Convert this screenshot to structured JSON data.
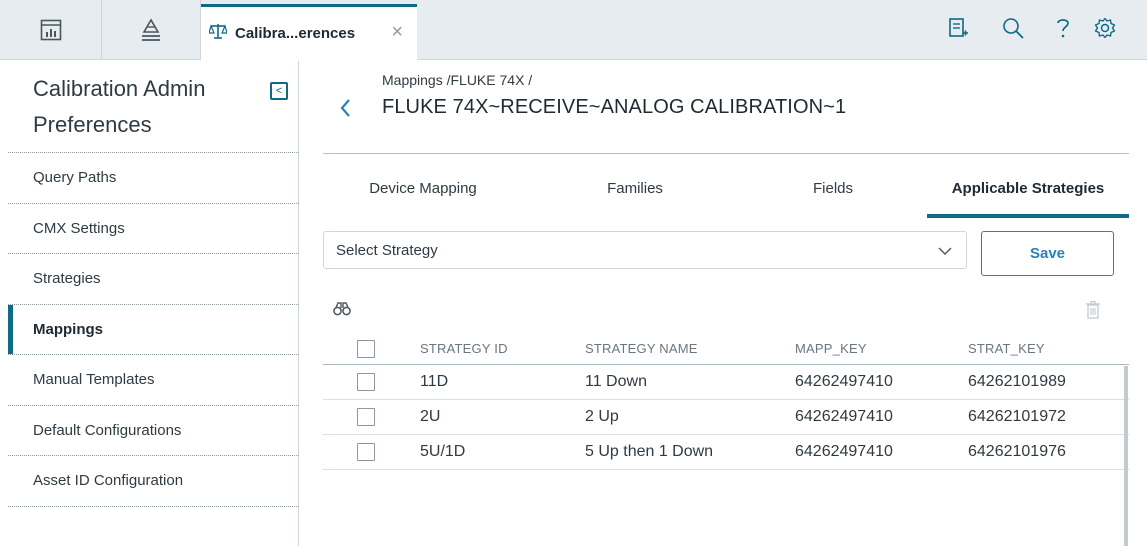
{
  "topbar": {
    "tab_label": "Calibra...erences",
    "tab_close": "×"
  },
  "sidebar": {
    "title": "Calibration Admin Preferences",
    "collapse_glyph": "<",
    "items": [
      {
        "label": "Query Paths",
        "active": false
      },
      {
        "label": "CMX Settings",
        "active": false
      },
      {
        "label": "Strategies",
        "active": false
      },
      {
        "label": "Mappings",
        "active": true
      },
      {
        "label": "Manual Templates",
        "active": false
      },
      {
        "label": "Default Configurations",
        "active": false
      },
      {
        "label": "Asset ID Configuration",
        "active": false
      }
    ]
  },
  "main": {
    "breadcrumb": "Mappings /FLUKE 74X /",
    "title": "FLUKE 74X~RECEIVE~ANALOG CALIBRATION~1",
    "tabs": [
      {
        "label": "Device Mapping",
        "active": false
      },
      {
        "label": "Families",
        "active": false
      },
      {
        "label": "Fields",
        "active": false
      },
      {
        "label": "Applicable Strategies",
        "active": true
      }
    ],
    "strategy_select": {
      "value": "Select Strategy"
    },
    "save_label": "Save"
  },
  "table": {
    "headers": [
      "STRATEGY ID",
      "STRATEGY NAME",
      "MAPP_KEY",
      "STRAT_KEY"
    ],
    "rows": [
      [
        "11D",
        "11 Down",
        "64262497410",
        "64262101989"
      ],
      [
        "2U",
        "2 Up",
        "64262497410",
        "64262101972"
      ],
      [
        "5U/1D",
        "5 Up then 1 Down",
        "64262497410",
        "64262101976"
      ]
    ]
  },
  "colors": {
    "accent": "#0f6b85",
    "link": "#2a7fbd",
    "topbar_bg": "#e6ecef"
  },
  "icons": [
    "dashboard-icon",
    "hierarchy-icon",
    "scale-icon",
    "close-icon",
    "report-add-icon",
    "search-icon",
    "help-icon",
    "gear-icon",
    "collapse-icon",
    "back-icon",
    "chevron-down-icon",
    "find-icon",
    "trash-icon"
  ]
}
